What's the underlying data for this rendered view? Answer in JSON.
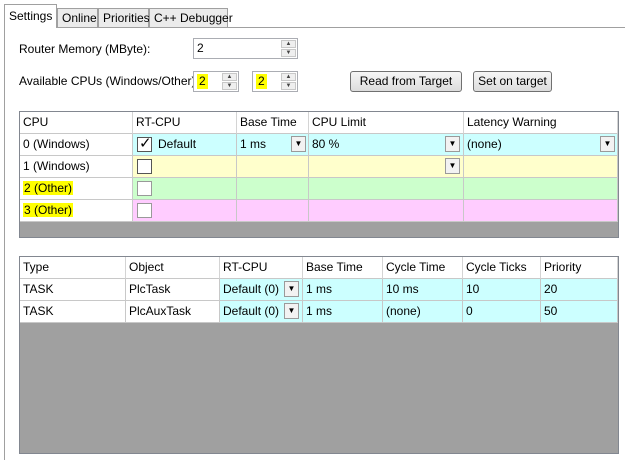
{
  "tabs": [
    {
      "label": "Settings",
      "active": true
    },
    {
      "label": "Online",
      "active": false
    },
    {
      "label": "Priorities",
      "active": false
    },
    {
      "label": "C++ Debugger",
      "active": false
    }
  ],
  "settings": {
    "router_memory_label": "Router Memory (MByte):",
    "router_memory_value": "2",
    "available_cpus_label": "Available CPUs (Windows/Other):",
    "cpus_windows_value": "2",
    "cpus_other_value": "2",
    "read_from_target_label": "Read from Target",
    "set_on_target_label": "Set on target"
  },
  "cpu_table": {
    "columns": [
      "CPU",
      "RT-CPU",
      "Base Time",
      "CPU Limit",
      "Latency Warning"
    ],
    "rows": [
      {
        "cpu": "0 (Windows)",
        "rt_checked": true,
        "rt_label": "Default",
        "base_time": "1 ms",
        "cpu_limit": "80 %",
        "latency": "(none)",
        "color": "#ccffff"
      },
      {
        "cpu": "1 (Windows)",
        "rt_checked": false,
        "rt_label": "",
        "base_time": "",
        "cpu_limit": "",
        "latency": "",
        "color": "#ffffcc"
      },
      {
        "cpu": "2 (Other)",
        "rt_checked": false,
        "rt_label": "",
        "base_time": "",
        "cpu_limit": "",
        "latency": "",
        "color": "#ccffcc"
      },
      {
        "cpu": "3 (Other)",
        "rt_checked": false,
        "rt_label": "",
        "base_time": "",
        "cpu_limit": "",
        "latency": "",
        "color": "#ffccff"
      }
    ]
  },
  "task_table": {
    "columns": [
      "Type",
      "Object",
      "RT-CPU",
      "Base Time",
      "Cycle Time",
      "Cycle Ticks",
      "Priority"
    ],
    "rows": [
      {
        "type": "TASK",
        "object": "PlcTask",
        "rt_cpu": "Default (0)",
        "base_time": "1 ms",
        "cycle_time": "10 ms",
        "cycle_ticks": "10",
        "priority": "20"
      },
      {
        "type": "TASK",
        "object": "PlcAuxTask",
        "rt_cpu": "Default (0)",
        "base_time": "1 ms",
        "cycle_time": "(none)",
        "cycle_ticks": "0",
        "priority": "50"
      }
    ],
    "data_color": "#ccffff"
  },
  "icons": {
    "dropdown": "chevron-down-icon",
    "spin_up": "arrow-up-icon",
    "spin_down": "arrow-down-icon",
    "check": "checkmark-icon"
  }
}
